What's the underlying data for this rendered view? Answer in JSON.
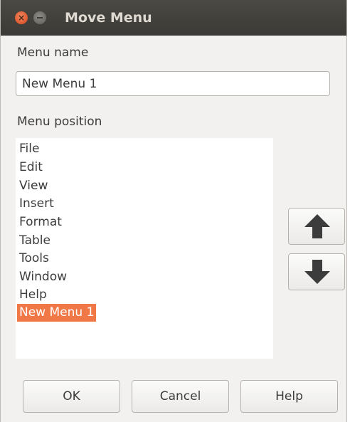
{
  "window": {
    "title": "Move Menu",
    "close_glyph": "×"
  },
  "form": {
    "name_label": "Menu name",
    "name_value": "New Menu 1",
    "position_label": "Menu position"
  },
  "menu_items": [
    {
      "label": "File",
      "selected": false
    },
    {
      "label": "Edit",
      "selected": false
    },
    {
      "label": "View",
      "selected": false
    },
    {
      "label": "Insert",
      "selected": false
    },
    {
      "label": "Format",
      "selected": false
    },
    {
      "label": "Table",
      "selected": false
    },
    {
      "label": "Tools",
      "selected": false
    },
    {
      "label": "Window",
      "selected": false
    },
    {
      "label": "Help",
      "selected": false
    },
    {
      "label": "New Menu 1",
      "selected": true
    }
  ],
  "move_buttons": {
    "up_icon": "arrow-up-icon",
    "down_icon": "arrow-down-icon"
  },
  "buttons": {
    "ok": "OK",
    "cancel": "Cancel",
    "help": "Help"
  },
  "colors": {
    "titlebar": "#3c3b37",
    "selection": "#f07746",
    "close_button": "#e0582f",
    "dialog_bg": "#f2f1f0"
  }
}
